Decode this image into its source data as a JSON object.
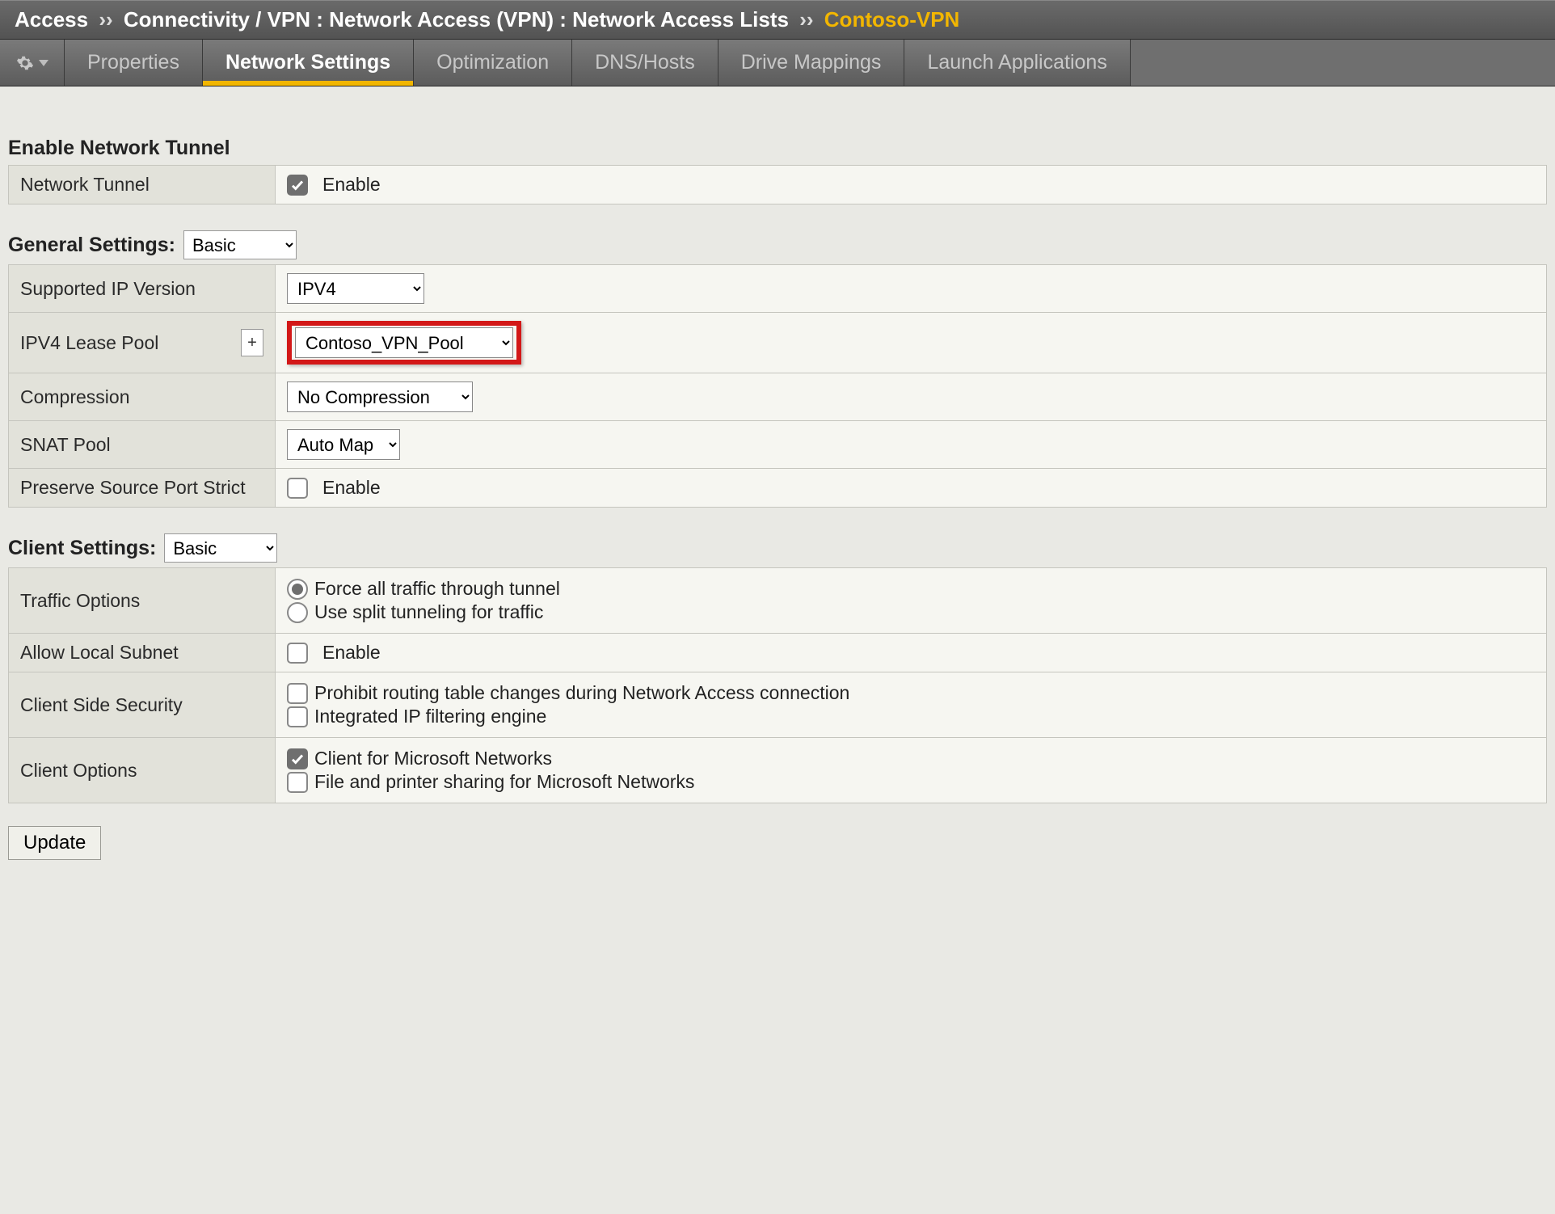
{
  "breadcrumb": {
    "root": "Access",
    "path": "Connectivity / VPN : Network Access (VPN) : Network Access Lists",
    "current": "Contoso-VPN",
    "sep": "››"
  },
  "tabs": [
    {
      "label": "Properties",
      "active": false
    },
    {
      "label": "Network Settings",
      "active": true
    },
    {
      "label": "Optimization",
      "active": false
    },
    {
      "label": "DNS/Hosts",
      "active": false
    },
    {
      "label": "Drive Mappings",
      "active": false
    },
    {
      "label": "Launch Applications",
      "active": false
    }
  ],
  "sections": {
    "enable_tunnel": {
      "heading": "Enable Network Tunnel",
      "row_label": "Network Tunnel",
      "enable_label": "Enable",
      "checked": true
    },
    "general": {
      "heading": "General Settings:",
      "mode_value": "Basic",
      "rows": {
        "ip_version": {
          "label": "Supported IP Version",
          "value": "IPV4"
        },
        "lease_pool": {
          "label": "IPV4 Lease Pool",
          "value": "Contoso_VPN_Pool",
          "plus": "+"
        },
        "compression": {
          "label": "Compression",
          "value": "No Compression"
        },
        "snat_pool": {
          "label": "SNAT Pool",
          "value": "Auto Map"
        },
        "preserve_port": {
          "label": "Preserve Source Port Strict",
          "enable_label": "Enable",
          "checked": false
        }
      }
    },
    "client": {
      "heading": "Client Settings:",
      "mode_value": "Basic",
      "rows": {
        "traffic": {
          "label": "Traffic Options",
          "opt_force": "Force all traffic through tunnel",
          "opt_split": "Use split tunneling for traffic",
          "selected": "force"
        },
        "allow_local": {
          "label": "Allow Local Subnet",
          "enable_label": "Enable",
          "checked": false
        },
        "client_security": {
          "label": "Client Side Security",
          "opt_routing": "Prohibit routing table changes during Network Access connection",
          "opt_filter": "Integrated IP filtering engine",
          "routing_checked": false,
          "filter_checked": false
        },
        "client_options": {
          "label": "Client Options",
          "opt_msnet": "Client for Microsoft Networks",
          "opt_fileshare": "File and printer sharing for Microsoft Networks",
          "msnet_checked": true,
          "fileshare_checked": false
        }
      }
    }
  },
  "buttons": {
    "update": "Update"
  }
}
